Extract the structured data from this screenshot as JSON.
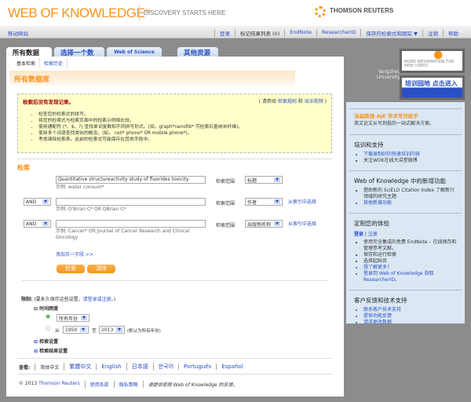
{
  "header": {
    "logo": "WEB OF KNOWLEDGE",
    "logo_sup": "SM",
    "tagline": "DISCOVERY STARTS HERE",
    "brand": "THOMSON REUTERS"
  },
  "nav": {
    "mobile": "移动网站",
    "items": [
      "登录",
      "标记结果列表 (0)",
      "EndNote",
      "ResearcherID",
      "保存的检索式和跟踪 ▼",
      "注销",
      "帮助"
    ]
  },
  "tabs": [
    "所有数据库",
    "选择一个数据库",
    "Web of Science",
    "其他资源"
  ],
  "subtabs": [
    "基本检索",
    "检索历史"
  ],
  "page_title": "所有数据库",
  "notice": {
    "title": "检索后没有发现记录。",
    "ref_pre": "( 请参阅",
    "ref_link1": "检索规则",
    "ref_and": "和",
    "ref_link2": "培训视频",
    "ref_post": ")",
    "tips": [
      "检查您的检索式的拼写。",
      "将您的检索式与检索页面中的检索示例相比较。",
      "使用通配符 (*、$、?) 查找单词复数和不同拼写形式。(如，graph*nanofib* 可检索石墨纳米纤维)。",
      "使用多个词语查找类似的概念。(如， cell* phone* OR mobile phone*)。",
      "考虑清除检索表。此前的检索式可能保存在其他字段中。"
    ]
  },
  "search": {
    "heading": "检索",
    "scope_label": "检索范围",
    "index_link": "从索引中选择",
    "rows": [
      {
        "bool": "",
        "value": "Quantitative structureactivity study of fluorides toxicity",
        "example": "示例: water consum*",
        "field": "标题"
      },
      {
        "bool": "AND",
        "value": "",
        "example": "示例: O'Brian C* OR OBrian C*",
        "field": "作者"
      },
      {
        "bool": "AND",
        "value": "",
        "example": "示例: Cancer* OR Journal of Cancer Research and Clinical Oncology",
        "field": "出版物名称"
      }
    ],
    "add_field": "添加另一字段 >>",
    "search_btn": "检索",
    "clear_btn": "清除"
  },
  "limits": {
    "label": "限制:",
    "note_pre": "(要永久保存这些设置，",
    "note_link": "请登录或注册。",
    "note_post": ")",
    "timespan": "时间跨度",
    "all_years": "所有年份",
    "from": "从",
    "from_year": "1950",
    "to": "至",
    "to_year": "2013",
    "default_note": "(默认为所有年份)",
    "search_settings": "检索设置",
    "result_settings": "检索结果设置"
  },
  "languages": {
    "label": "查看:",
    "items": [
      "简体中文",
      "繁體中文",
      "English",
      "日本語",
      "한국어",
      "Português",
      "Español"
    ]
  },
  "footer": {
    "copyright": "© 2013",
    "tr_link": "Thomson Reuters",
    "terms": "使用条款",
    "privacy": "隐私策略",
    "feedback": "请提供使用 Web of Knowledge 的反馈。"
  },
  "sidebar": {
    "institution": "Yangzhou University",
    "ad1": "MORE INFORMATION FOR NEW USERS",
    "ad2": "培训园地 点击进入",
    "aje_title": "汤森路透-AJE 学术写作助手",
    "aje_desc": "英文论文从写到投的一站式解决方案。",
    "training": {
      "title": "培训和支持",
      "items": [
        "下载录制好的快速培训内容",
        "关注WOK在线大讲堂微博"
      ]
    },
    "new": {
      "title": "Web of Knowledge 中的新增功能",
      "items": [
        "借助新的 SciELO Citation Index 了解新兴领域的研究主题",
        "其他新增功能"
      ]
    },
    "custom": {
      "title": "定制您的体验",
      "login": "登录",
      "register": "注册",
      "items": [
        "使用完全集成的免费 EndNote – 在线保存和管理参考文献。",
        "保存和运行检索",
        "选择起始页",
        "想了解更多?",
        "登录到 Web of Knowledge 获取 ResearcherID。"
      ]
    },
    "support": {
      "title": "客户反馈和技术支持",
      "items": [
        "联系客户技术支持",
        "提供功能反馈",
        "请求更改数据"
      ]
    }
  }
}
